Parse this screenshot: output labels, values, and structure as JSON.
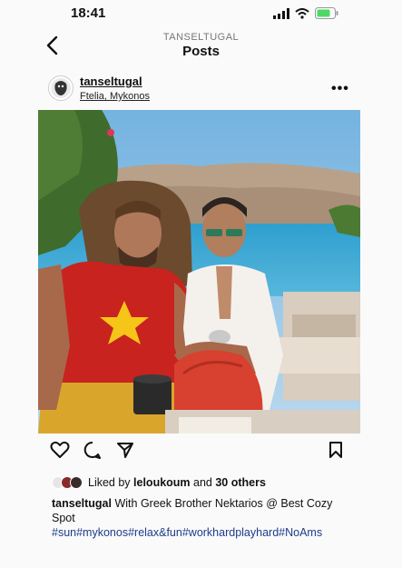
{
  "status_bar": {
    "time": "18:41"
  },
  "header": {
    "account": "TANSELTUGAL",
    "title": "Posts"
  },
  "post": {
    "username": "tanseltugal",
    "location": "Ftelia, Mykonos",
    "more": "•••",
    "likes": {
      "prefix": "Liked by ",
      "user": "leloukoum",
      "middle": " and ",
      "others": "30 others"
    },
    "caption": {
      "username": "tanseltugal",
      "text": " With Greek Brother Nektarios @ Best Cozy Spot",
      "hashtags": "#sun#mykonos#relax&fun#workhardplayhard#NoAms"
    }
  }
}
